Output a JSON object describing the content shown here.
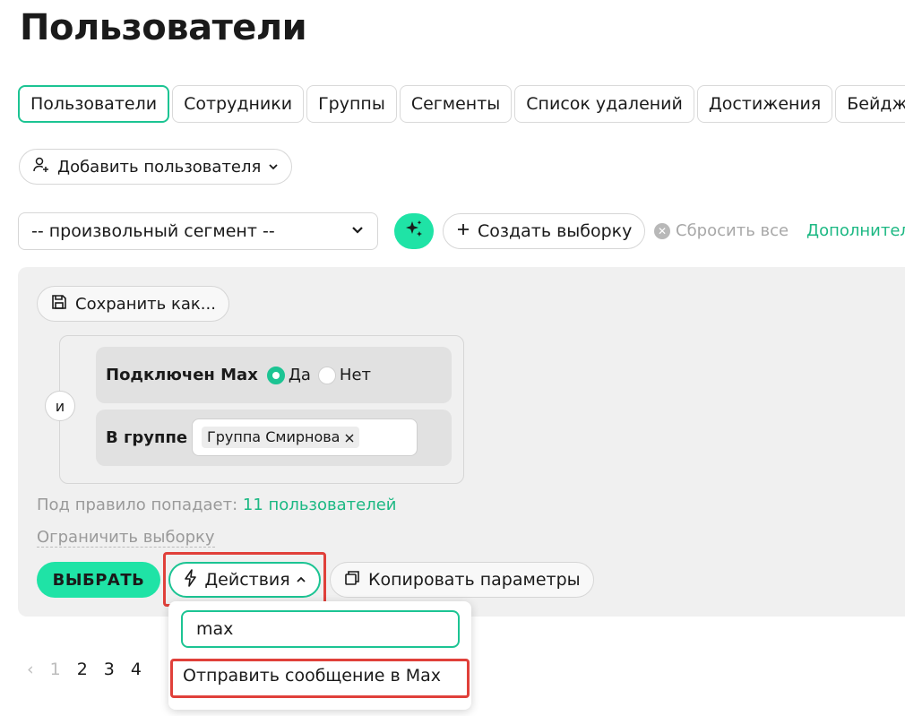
{
  "page": {
    "title": "Пользователи"
  },
  "tabs": [
    {
      "label": "Пользователи",
      "active": true
    },
    {
      "label": "Сотрудники",
      "active": false
    },
    {
      "label": "Группы",
      "active": false
    },
    {
      "label": "Сегменты",
      "active": false
    },
    {
      "label": "Список удалений",
      "active": false
    },
    {
      "label": "Достижения",
      "active": false
    },
    {
      "label": "Бейджи",
      "active": false
    }
  ],
  "toolbar": {
    "add_user_label": "Добавить пользователя",
    "segment_select_value": "-- произвольный сегмент --",
    "create_selection_label": "Создать выборку",
    "reset_all_label": "Сбросить все",
    "advanced_label": "Дополнительно"
  },
  "filter": {
    "save_as_label": "Сохранить как...",
    "and_label": "и",
    "rule1": {
      "label": "Подключен Max",
      "option_yes": "Да",
      "option_no": "Нет",
      "selected": "Да"
    },
    "rule2": {
      "label": "В группе",
      "chip": "Группа Смирнова"
    },
    "match_prefix": "Под правило попадает:",
    "match_count": "11 пользователей",
    "limit_label": "Ограничить выборку",
    "select_button_label": "ВЫБРАТЬ",
    "actions_label": "Действия",
    "copy_params_label": "Копировать параметры"
  },
  "actions_dropdown": {
    "search_value": "max",
    "items": [
      "Отправить сообщение в Max"
    ]
  },
  "pagination": {
    "prev": "‹",
    "pages": [
      "1",
      "2",
      "3",
      "4"
    ],
    "current": "1"
  },
  "colors": {
    "accent": "#1fe3a6",
    "accent_border": "#1cc493",
    "highlight": "#e0403a"
  }
}
